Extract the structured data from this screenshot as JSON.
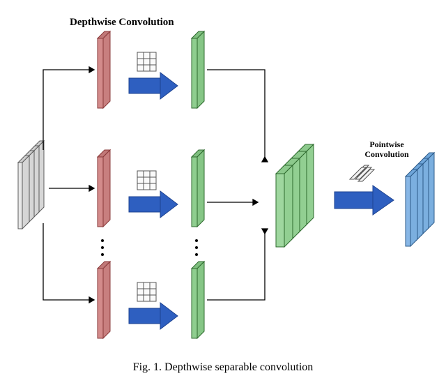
{
  "titles": {
    "depthwise": "Depthwise Convolution",
    "pointwise_line1": "Pointwise",
    "pointwise_line2": "Convolution"
  },
  "caption": "Fig. 1. Depthwise separable convolution",
  "diagram": {
    "colors": {
      "input_fill": "#e8e8e8",
      "input_stroke": "#5c5c5c",
      "split_fill": "#d38b8b",
      "split_stroke": "#8a3a3a",
      "dw_out_fill": "#8fce8f",
      "dw_out_stroke": "#2f6b2f",
      "stack_fill": "#9fd79f",
      "stack_stroke": "#2f6b2f",
      "pw_out_fill": "#88b7e6",
      "pw_out_stroke": "#2c5b8a",
      "arrow": "#2e5fc0",
      "line": "#000000",
      "kernel_stroke": "#555555"
    }
  }
}
